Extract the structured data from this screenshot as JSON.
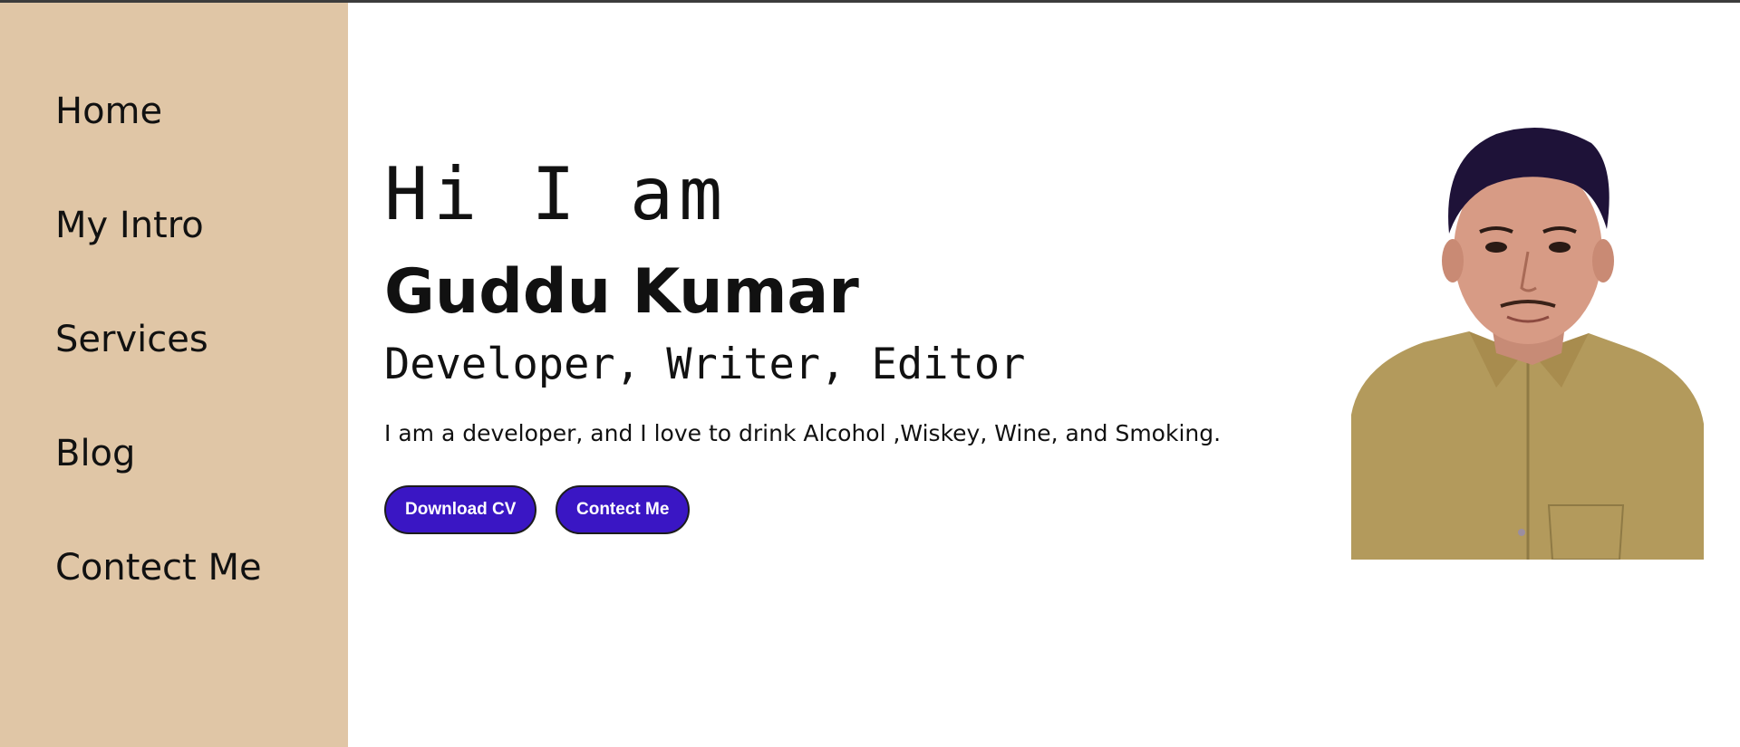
{
  "sidebar": {
    "items": [
      {
        "label": "Home"
      },
      {
        "label": "My Intro"
      },
      {
        "label": "Services"
      },
      {
        "label": "Blog"
      },
      {
        "label": "Contect Me"
      }
    ]
  },
  "hero": {
    "greeting": "Hi I am",
    "name": "Guddu Kumar",
    "roles": "Developer, Writer, Editor",
    "description": "I am a developer, and I love to drink Alcohol ,Wiskey, Wine, and Smoking.",
    "buttons": {
      "download_cv": "Download CV",
      "contact": "Contect Me"
    },
    "portrait_icon": "profile-photo"
  },
  "colors": {
    "sidebar_bg": "#e0c6a6",
    "button_bg": "#3a16c4",
    "text": "#111111"
  }
}
